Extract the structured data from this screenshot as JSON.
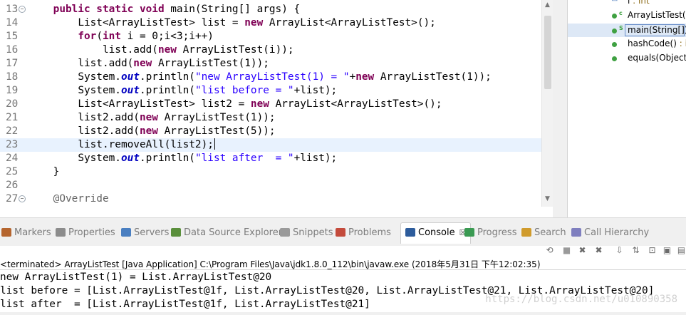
{
  "editor": {
    "lines": [
      {
        "num": "13",
        "fold": "⊖",
        "indent": "    ",
        "tokens": [
          {
            "t": "public static void",
            "c": "kw"
          },
          {
            "t": " main(String[] args) {"
          }
        ]
      },
      {
        "num": "14",
        "indent": "        ",
        "tokens": [
          {
            "t": "List<ArrayListTest> list = "
          },
          {
            "t": "new",
            "c": "kw"
          },
          {
            "t": " ArrayList<ArrayListTest>();"
          }
        ]
      },
      {
        "num": "15",
        "indent": "        ",
        "tokens": [
          {
            "t": "for",
            "c": "kw"
          },
          {
            "t": "("
          },
          {
            "t": "int",
            "c": "kw"
          },
          {
            "t": " i = 0;i<3;i++)"
          }
        ]
      },
      {
        "num": "16",
        "indent": "            ",
        "tokens": [
          {
            "t": "list.add("
          },
          {
            "t": "new",
            "c": "kw"
          },
          {
            "t": " ArrayListTest(i));"
          }
        ]
      },
      {
        "num": "17",
        "indent": "        ",
        "tokens": [
          {
            "t": "list.add("
          },
          {
            "t": "new",
            "c": "kw"
          },
          {
            "t": " ArrayListTest(1));"
          }
        ]
      },
      {
        "num": "18",
        "indent": "        ",
        "tokens": [
          {
            "t": "System."
          },
          {
            "t": "out",
            "c": "fld"
          },
          {
            "t": ".println("
          },
          {
            "t": "\"new ArrayListTest(1) = \"",
            "c": "str"
          },
          {
            "t": "+"
          },
          {
            "t": "new",
            "c": "kw"
          },
          {
            "t": " ArrayListTest(1));"
          }
        ]
      },
      {
        "num": "19",
        "indent": "        ",
        "tokens": [
          {
            "t": "System."
          },
          {
            "t": "out",
            "c": "fld"
          },
          {
            "t": ".println("
          },
          {
            "t": "\"list before = \"",
            "c": "str"
          },
          {
            "t": "+list);"
          }
        ]
      },
      {
        "num": "20",
        "indent": "        ",
        "tokens": [
          {
            "t": "List<ArrayListTest> list2 = "
          },
          {
            "t": "new",
            "c": "kw"
          },
          {
            "t": " ArrayList<ArrayListTest>();"
          }
        ]
      },
      {
        "num": "21",
        "indent": "        ",
        "tokens": [
          {
            "t": "list2.add("
          },
          {
            "t": "new",
            "c": "kw"
          },
          {
            "t": " ArrayListTest(1));"
          }
        ]
      },
      {
        "num": "22",
        "indent": "        ",
        "tokens": [
          {
            "t": "list2.add("
          },
          {
            "t": "new",
            "c": "kw"
          },
          {
            "t": " ArrayListTest(5));"
          }
        ]
      },
      {
        "num": "23",
        "indent": "        ",
        "current": true,
        "tokens": [
          {
            "t": "list.removeAll(list2);"
          }
        ]
      },
      {
        "num": "24",
        "indent": "        ",
        "tokens": [
          {
            "t": "System."
          },
          {
            "t": "out",
            "c": "fld"
          },
          {
            "t": ".println("
          },
          {
            "t": "\"list after  = \"",
            "c": "str"
          },
          {
            "t": "+list);"
          }
        ]
      },
      {
        "num": "25",
        "indent": "    ",
        "tokens": [
          {
            "t": "}"
          }
        ]
      },
      {
        "num": "26",
        "indent": "",
        "tokens": []
      },
      {
        "num": "27",
        "fold": "⊖",
        "indent": "    ",
        "tokens": [
          {
            "t": "@Override",
            "c": "ann"
          }
        ]
      }
    ]
  },
  "outline": {
    "items": [
      {
        "label": "i",
        "type": " : int",
        "marker": "△",
        "partial": true
      },
      {
        "label": "ArrayListTest(i",
        "sup": "c"
      },
      {
        "label": "main(String[])",
        "sup": "S",
        "selected": true
      },
      {
        "label": "hashCode()",
        "type": " : ir"
      },
      {
        "label": "equals(Object)"
      }
    ]
  },
  "tabs": [
    {
      "label": "Markers",
      "icon": "markers-icon",
      "color": "#b5652e"
    },
    {
      "label": "Properties",
      "icon": "properties-icon",
      "color": "#8c8c8c"
    },
    {
      "label": "Servers",
      "icon": "servers-icon",
      "color": "#4a7fc1"
    },
    {
      "label": "Data Source Explorer",
      "icon": "data-source-icon",
      "color": "#5a8f3c"
    },
    {
      "label": "Snippets",
      "icon": "snippets-icon",
      "color": "#9a9a9a"
    },
    {
      "label": "Problems",
      "icon": "problems-icon",
      "color": "#c44b3c"
    },
    {
      "label": "Console",
      "icon": "console-icon",
      "color": "#2d5c9c",
      "active": true,
      "close": "☒"
    },
    {
      "label": "Progress",
      "icon": "progress-icon",
      "color": "#3a9a52"
    },
    {
      "label": "Search",
      "icon": "search-icon",
      "color": "#d09b2c"
    },
    {
      "label": "Call Hierarchy",
      "icon": "call-hierarchy-icon",
      "color": "#7f7fbf"
    }
  ],
  "console": {
    "terminated": "<terminated> ArrayListTest [Java Application] C:\\Program Files\\Java\\jdk1.8.0_112\\bin\\javaw.exe (2018年5月31日 下午12:02:35)",
    "output": [
      "new ArrayListTest(1) = List.ArrayListTest@20",
      "list before = [List.ArrayListTest@1f, List.ArrayListTest@20, List.ArrayListTest@21, List.ArrayListTest@20]",
      "list after  = [List.ArrayListTest@1f, List.ArrayListTest@21]"
    ],
    "toolbar": [
      {
        "name": "link-icon",
        "glyph": "⟲"
      },
      {
        "name": "stop-icon",
        "glyph": "■"
      },
      {
        "name": "remove-launch-icon",
        "glyph": "✖"
      },
      {
        "name": "remove-all-icon",
        "glyph": "✖"
      },
      {
        "name": "scroll-lock-icon",
        "glyph": "⇩"
      },
      {
        "name": "word-wrap-icon",
        "glyph": "⇅"
      },
      {
        "name": "pin-icon",
        "glyph": "⊡"
      },
      {
        "name": "display-console-icon",
        "glyph": "▣"
      },
      {
        "name": "open-console-icon",
        "glyph": "▤"
      },
      {
        "name": "new-console-icon",
        "glyph": "⊞"
      }
    ]
  },
  "watermark": "https://blog.csdn.net/u010890358"
}
